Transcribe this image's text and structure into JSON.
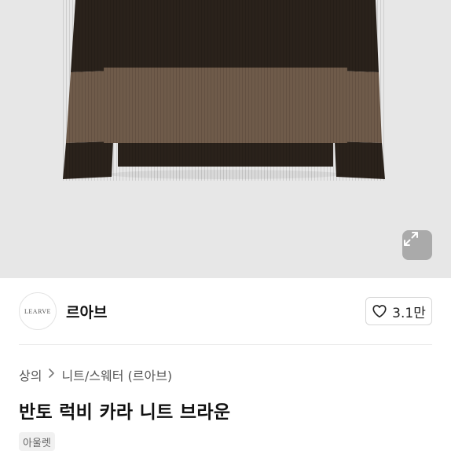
{
  "product_image": {
    "alt": "",
    "colors": {
      "background": "#e7e7e7",
      "knit_dark": "#2a221b",
      "knit_stripe": "#6f5b4a"
    }
  },
  "expand_button": {
    "icon": "expand-diagonal-icon"
  },
  "seller": {
    "avatar_text": "LEARVE",
    "name": "르아브",
    "like_icon": "heart-outline-icon",
    "like_count": "3.1만"
  },
  "breadcrumb": {
    "items": [
      "상의",
      "니트/스웨터 (르아브)"
    ],
    "separator_icon": "chevron-right-icon"
  },
  "product": {
    "title": "반토 럭비 카라 니트 브라운",
    "tag": "아울렛"
  }
}
